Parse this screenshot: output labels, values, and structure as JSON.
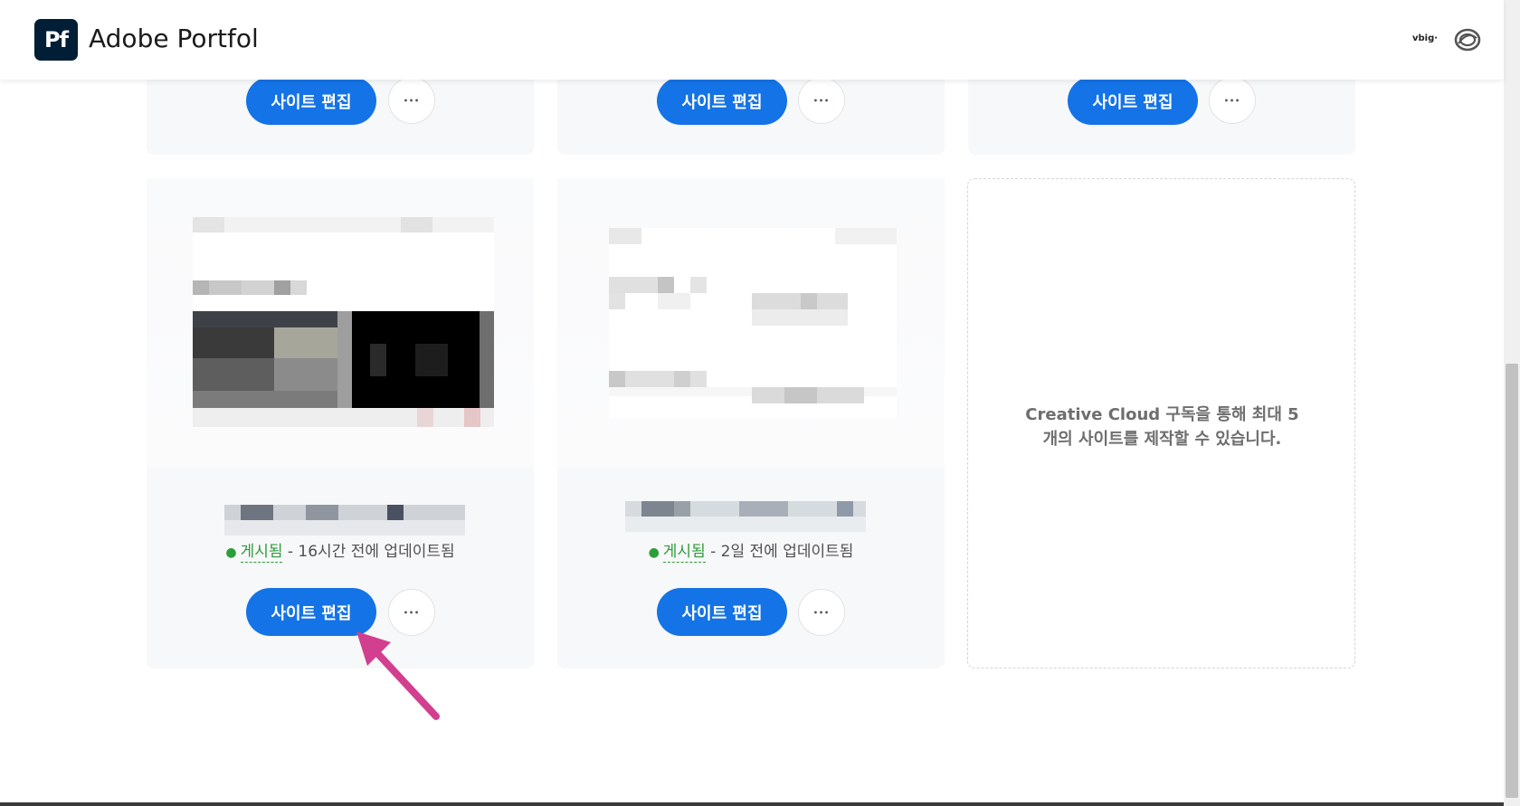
{
  "header": {
    "logo_text": "Pf",
    "app_title": "Adobe Portfol",
    "user_badge": "vbig·"
  },
  "sites": [
    {
      "edit_label": "사이트 편집",
      "more_label": "•••"
    },
    {
      "edit_label": "사이트 편집",
      "more_label": "•••"
    },
    {
      "edit_label": "사이트 편집",
      "more_label": "•••"
    },
    {
      "edit_label": "사이트 편집",
      "more_label": "•••",
      "status_published": "게시됨",
      "status_updated": " - 16시간 전에 업데이트됨"
    },
    {
      "edit_label": "사이트 편집",
      "more_label": "•••",
      "status_published": "게시됨",
      "status_updated": " - 2일 전에 업데이트됨"
    }
  ],
  "placeholder": {
    "line1": "Creative Cloud 구독을 통해 최대 5",
    "line2": "개의 사이트를 제작할 수 있습니다."
  },
  "colors": {
    "accent": "#1473e6",
    "published": "#2d9d3a",
    "annotation_arrow": "#d23f8f"
  },
  "icons": {
    "logo": "portfolio-logo-icon",
    "creative_cloud": "creative-cloud-icon",
    "more": "more-horizontal-icon"
  }
}
